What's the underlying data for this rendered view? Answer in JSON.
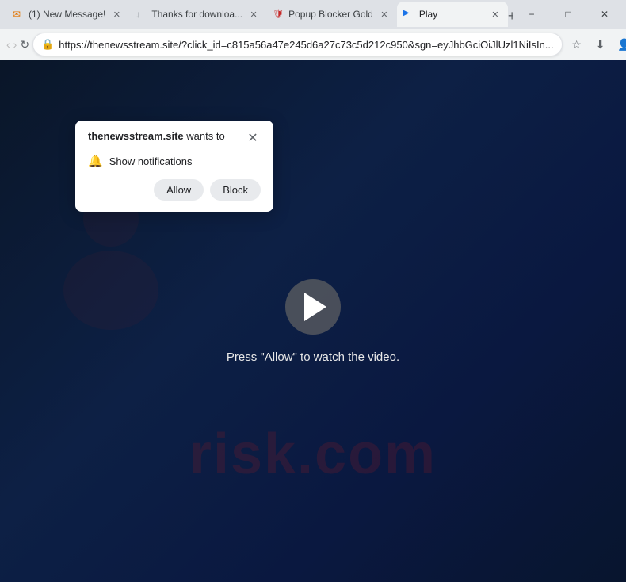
{
  "browser": {
    "window_controls": {
      "minimize": "−",
      "maximize": "□",
      "close": "✕"
    },
    "tabs": [
      {
        "id": "tab1",
        "favicon": "✉",
        "favicon_color": "favicon-orange",
        "title": "(1) New Message!",
        "active": false,
        "close": "✕"
      },
      {
        "id": "tab2",
        "favicon": "↓",
        "favicon_color": "favicon-gray",
        "title": "Thanks for downloa...",
        "active": false,
        "close": "✕"
      },
      {
        "id": "tab3",
        "favicon": "🛡",
        "favicon_color": "favicon-red",
        "title": "Popup Blocker Gold",
        "active": false,
        "close": "✕"
      },
      {
        "id": "tab4",
        "favicon": "▶",
        "favicon_color": "favicon-blue",
        "title": "Play",
        "active": true,
        "close": "✕"
      }
    ],
    "new_tab_icon": "+",
    "nav": {
      "back": "‹",
      "forward": "›",
      "reload": "↻",
      "url": "https://thenewsstream.site/?click_id=c815a56a47e245d6a27c73c5d212c950&sgn=eyJhbGciOiJlUzl1NiIsIn...",
      "bookmark": "☆",
      "download": "⬇",
      "profile": "👤",
      "menu": "⋮"
    }
  },
  "notification_popup": {
    "title_normal": " wants to",
    "title_bold": "thenewsstream.site",
    "close_icon": "✕",
    "notification_item": {
      "icon": "🔔",
      "label": "Show notifications"
    },
    "buttons": {
      "allow": "Allow",
      "block": "Block"
    }
  },
  "page": {
    "watermark": "risk.com",
    "play_button_label": "▶",
    "press_allow_text": "Press \"Allow\" to watch the video."
  }
}
